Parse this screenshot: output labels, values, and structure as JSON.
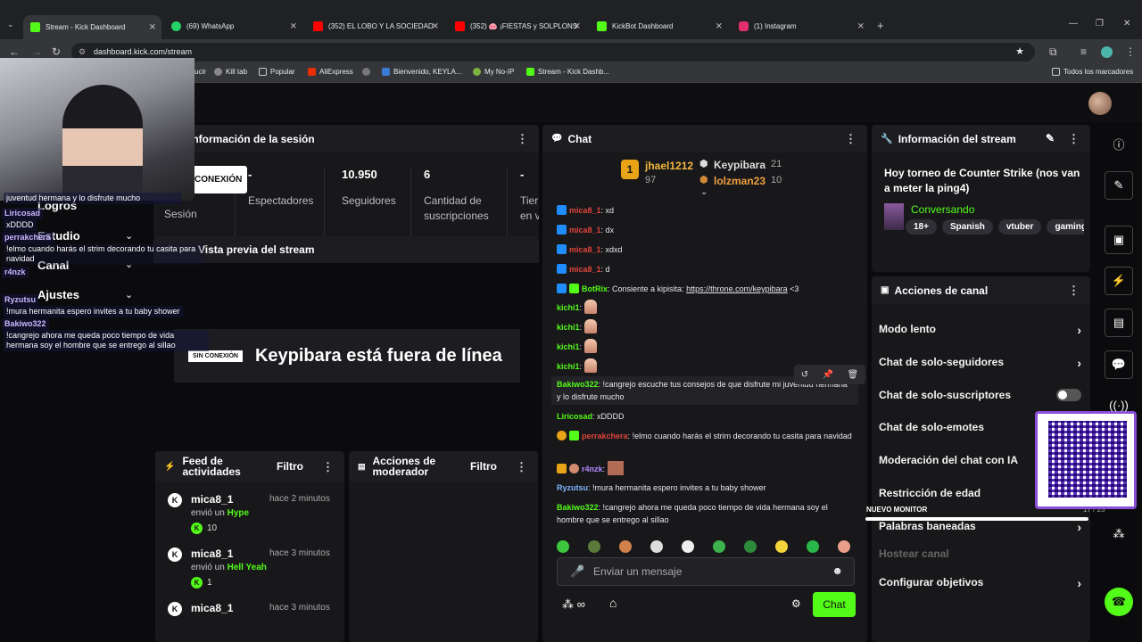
{
  "browser": {
    "tabs": [
      {
        "title": "Stream - Kick Dashboard",
        "color": "#53fc18"
      },
      {
        "title": "(69) WhatsApp",
        "color": "#25d366"
      },
      {
        "title": "(352) EL LOBO Y LA SOCIEDAD",
        "color": "#ff0000"
      },
      {
        "title": "(352) 🐽 ¡FIESTAS y SOLPLONS",
        "color": "#ff0000"
      },
      {
        "title": "KickBot Dashboard",
        "color": "#53fc18"
      },
      {
        "title": "(1) Instagram",
        "color": "#e1306c"
      }
    ],
    "url": "dashboard.kick.com/stream",
    "bookmarks": [
      "Kill tab",
      "Popular",
      "AliExpress",
      "Bienvenido, KEYLA...",
      "My No-IP",
      "Stream - Kick Dashb...",
      "Todos los marcadores",
      "ucir"
    ]
  },
  "sidebar": {
    "items": [
      {
        "label": "Logros"
      },
      {
        "label": "Estudio"
      },
      {
        "label": "Canal"
      },
      {
        "label": "Ajustes"
      }
    ]
  },
  "overlay_chat": [
    {
      "user": "",
      "text": "juventud hermana y lo disfrute mucho"
    },
    {
      "user": "Liricosad",
      "text": "xDDDD"
    },
    {
      "user": "perrakchera",
      "text": "!elmo cuando harás el strim decorando tu casita para navidad"
    },
    {
      "user": "r4nzk",
      "text": ""
    },
    {
      "user": "Ryzutsu",
      "text": "!mura hermanita espero invites a tu baby shower"
    },
    {
      "user": "Bakiwo322",
      "text": "!cangrejo ahora me queda poco tiempo de vida hermana soy el hombre que se entrego al sillao"
    }
  ],
  "session": {
    "title": "Información de la sesión",
    "status_button": "CONEXIÓN",
    "status_label": "Sesión",
    "stats": [
      {
        "value": "-",
        "label": "Espectadores"
      },
      {
        "value": "10.950",
        "label": "Seguidores"
      },
      {
        "value": "6",
        "label": "Cantidad de suscripciones"
      },
      {
        "value": "-",
        "label": "Tier en v"
      }
    ]
  },
  "preview": {
    "title": "Vista previa del stream",
    "offline_badge": "SIN CONEXIÓN",
    "offline_text": "Keypibara está fuera de línea"
  },
  "feed": {
    "title": "Feed de actividades",
    "filter": "Filtro",
    "items": [
      {
        "user": "mica8_1",
        "time": "hace 2 minutos",
        "sent": "envió un",
        "gift": "Hype",
        "amount": "10"
      },
      {
        "user": "mica8_1",
        "time": "hace 3 minutos",
        "sent": "envió un",
        "gift": "Hell Yeah",
        "amount": "1"
      },
      {
        "user": "mica8_1",
        "time": "hace 3 minutos",
        "sent": "",
        "gift": "",
        "amount": ""
      }
    ]
  },
  "mod": {
    "title": "Acciones de moderador",
    "filter": "Filtro"
  },
  "chat": {
    "title": "Chat",
    "leaderboard": [
      {
        "rank": "1",
        "name": "jhael1212",
        "score": "97"
      },
      {
        "rank": "",
        "name": "Keypibara",
        "score": "21"
      },
      {
        "rank": "",
        "name": "lolzman23",
        "score": "10"
      }
    ],
    "messages": [
      {
        "user": "mica8_1",
        "text": "xd"
      },
      {
        "user": "mica8_1",
        "text": "dx"
      },
      {
        "user": "mica8_1",
        "text": "xdxd"
      },
      {
        "user": "mica8_1",
        "text": "d"
      },
      {
        "user": "BotRix",
        "text": "Consiente a kipisita:",
        "link": "https://throne.com/keypibara",
        "tail": "<3"
      },
      {
        "user": "kichi1",
        "text": ""
      },
      {
        "user": "kichi1",
        "text": ""
      },
      {
        "user": "kichi1",
        "text": ""
      },
      {
        "user": "kichi1",
        "text": ""
      },
      {
        "user": "Bakiwo322",
        "text": "!cangrejo escuche tus consejos de que disfrute mi juventud hermana y lo disfrute mucho"
      },
      {
        "user": "Liricosad",
        "text": "xDDDD"
      },
      {
        "user": "perrakchera",
        "text": "!elmo cuando harás el strim decorando tu casita para navidad"
      },
      {
        "user": "r4nzk",
        "text": ""
      },
      {
        "user": "Ryzutsu",
        "text": "!mura hermanita espero invites a tu baby shower"
      },
      {
        "user": "Bakiwo322",
        "text": "!cangrejo ahora me queda poco tiempo de vida hermana soy el hombre que se entrego al sillao"
      }
    ],
    "input_placeholder": "Enviar un mensaje",
    "send_label": "Chat"
  },
  "stream_info": {
    "title": "Información del stream",
    "stream_title": "Hoy torneo de Counter Strike (nos van a meter la ping4)",
    "category": "Conversando",
    "tags": [
      "18+",
      "Spanish",
      "vtuber",
      "gaming"
    ]
  },
  "channel_actions": {
    "title": "Acciones de canal",
    "items": [
      {
        "label": "Modo lento"
      },
      {
        "label": "Chat de solo-seguidores"
      },
      {
        "label": "Chat de solo-suscriptores"
      },
      {
        "label": "Chat de solo-emotes"
      },
      {
        "label": "Moderación del chat con IA"
      },
      {
        "label": "Restricción de edad"
      },
      {
        "label": "Palabras baneadas"
      },
      {
        "label": "Hostear canal"
      },
      {
        "label": "Configurar objetivos"
      }
    ],
    "monitor_label": "NUEVO MONITOR",
    "monitor_count": "17 / 25"
  },
  "colors": {
    "accent": "#53fc18",
    "panel": "#18181b",
    "mod_badge": "#1f8cff",
    "highlight": "#53fc18"
  }
}
